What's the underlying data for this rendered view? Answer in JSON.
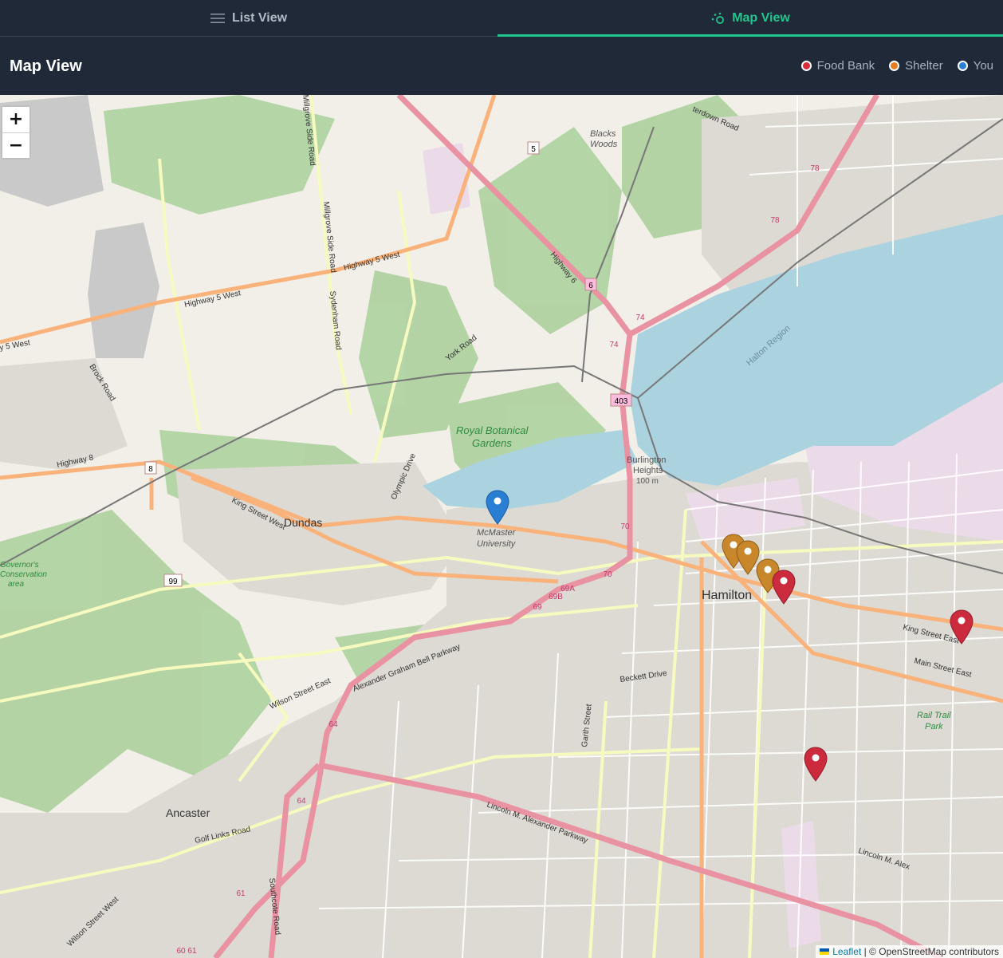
{
  "tabs": {
    "list": {
      "label": "List View",
      "icon": "list-icon"
    },
    "map": {
      "label": "Map View",
      "icon": "map-pins-icon",
      "active": true
    }
  },
  "header": {
    "title": "Map View"
  },
  "legend": [
    {
      "label": "Food Bank",
      "color": "#dc2b3a"
    },
    {
      "label": "Shelter",
      "color": "#e67e22"
    },
    {
      "label": "You",
      "color": "#2a7fd4"
    }
  ],
  "zoom": {
    "in_label": "+",
    "out_label": "−"
  },
  "attribution": {
    "leaflet": "Leaflet",
    "separator": " | © ",
    "osm": "OpenStreetMap contributors"
  },
  "map_labels": {
    "hamilton": "Hamilton",
    "dundas": "Dundas",
    "ancaster": "Ancaster",
    "royal_botanical": "Royal Botanical",
    "gardens": "Gardens",
    "mcmaster": "McMaster",
    "university": "University",
    "burlington": "Burlington",
    "heights": "Heights",
    "heights_elev": "100 m",
    "blacks": "Blacks",
    "woods": "Woods",
    "halton": "Halton Region",
    "rail_trail": "Rail Trail",
    "park": "Park",
    "governors_1": "Governor's",
    "governors_2": "Conservation",
    "governors_3": "area",
    "hwy5w": "Highway 5 West",
    "hwy5w_2": "Highway 5 West",
    "hwy5w_3": "y 5 West",
    "hwy6": "Highway 6",
    "hwy8": "Highway 8",
    "king_w": "King Street West",
    "king_e": "King Street East",
    "main_e": "Main Street East",
    "agb": "Alexander Graham Bell Parkway",
    "lincoln": "Lincoln M. Alexander Parkway",
    "lincoln_2": "Lincoln M. Alex",
    "wilson_e": "Wilson Street East",
    "wilson": "Wilson Street West",
    "golf": "Golf Links Road",
    "york": "York Road",
    "brock": "Brock Road",
    "olympic": "Olympic Drive",
    "millgrove": "Millgrove Side Road",
    "millgrove_2": "Millgrove Side Road",
    "sydenham": "Sydenham Road",
    "southcote": "Southcote Road",
    "garth": "Garth Street",
    "beckett": "Beckett Drive",
    "waterdown": "terdown Road",
    "s5": "5",
    "s6": "6",
    "s8": "8",
    "s99": "99",
    "s403": "403",
    "s74": "74",
    "s74b": "74",
    "s78": "78",
    "s78b": "78",
    "s70": "70",
    "s70b": "70",
    "s69": "69",
    "s69a": "69A",
    "s69b": "69B",
    "s64": "64",
    "s64b": "64",
    "s61": "61",
    "s6061": "60 61",
    "s99b": "99"
  }
}
